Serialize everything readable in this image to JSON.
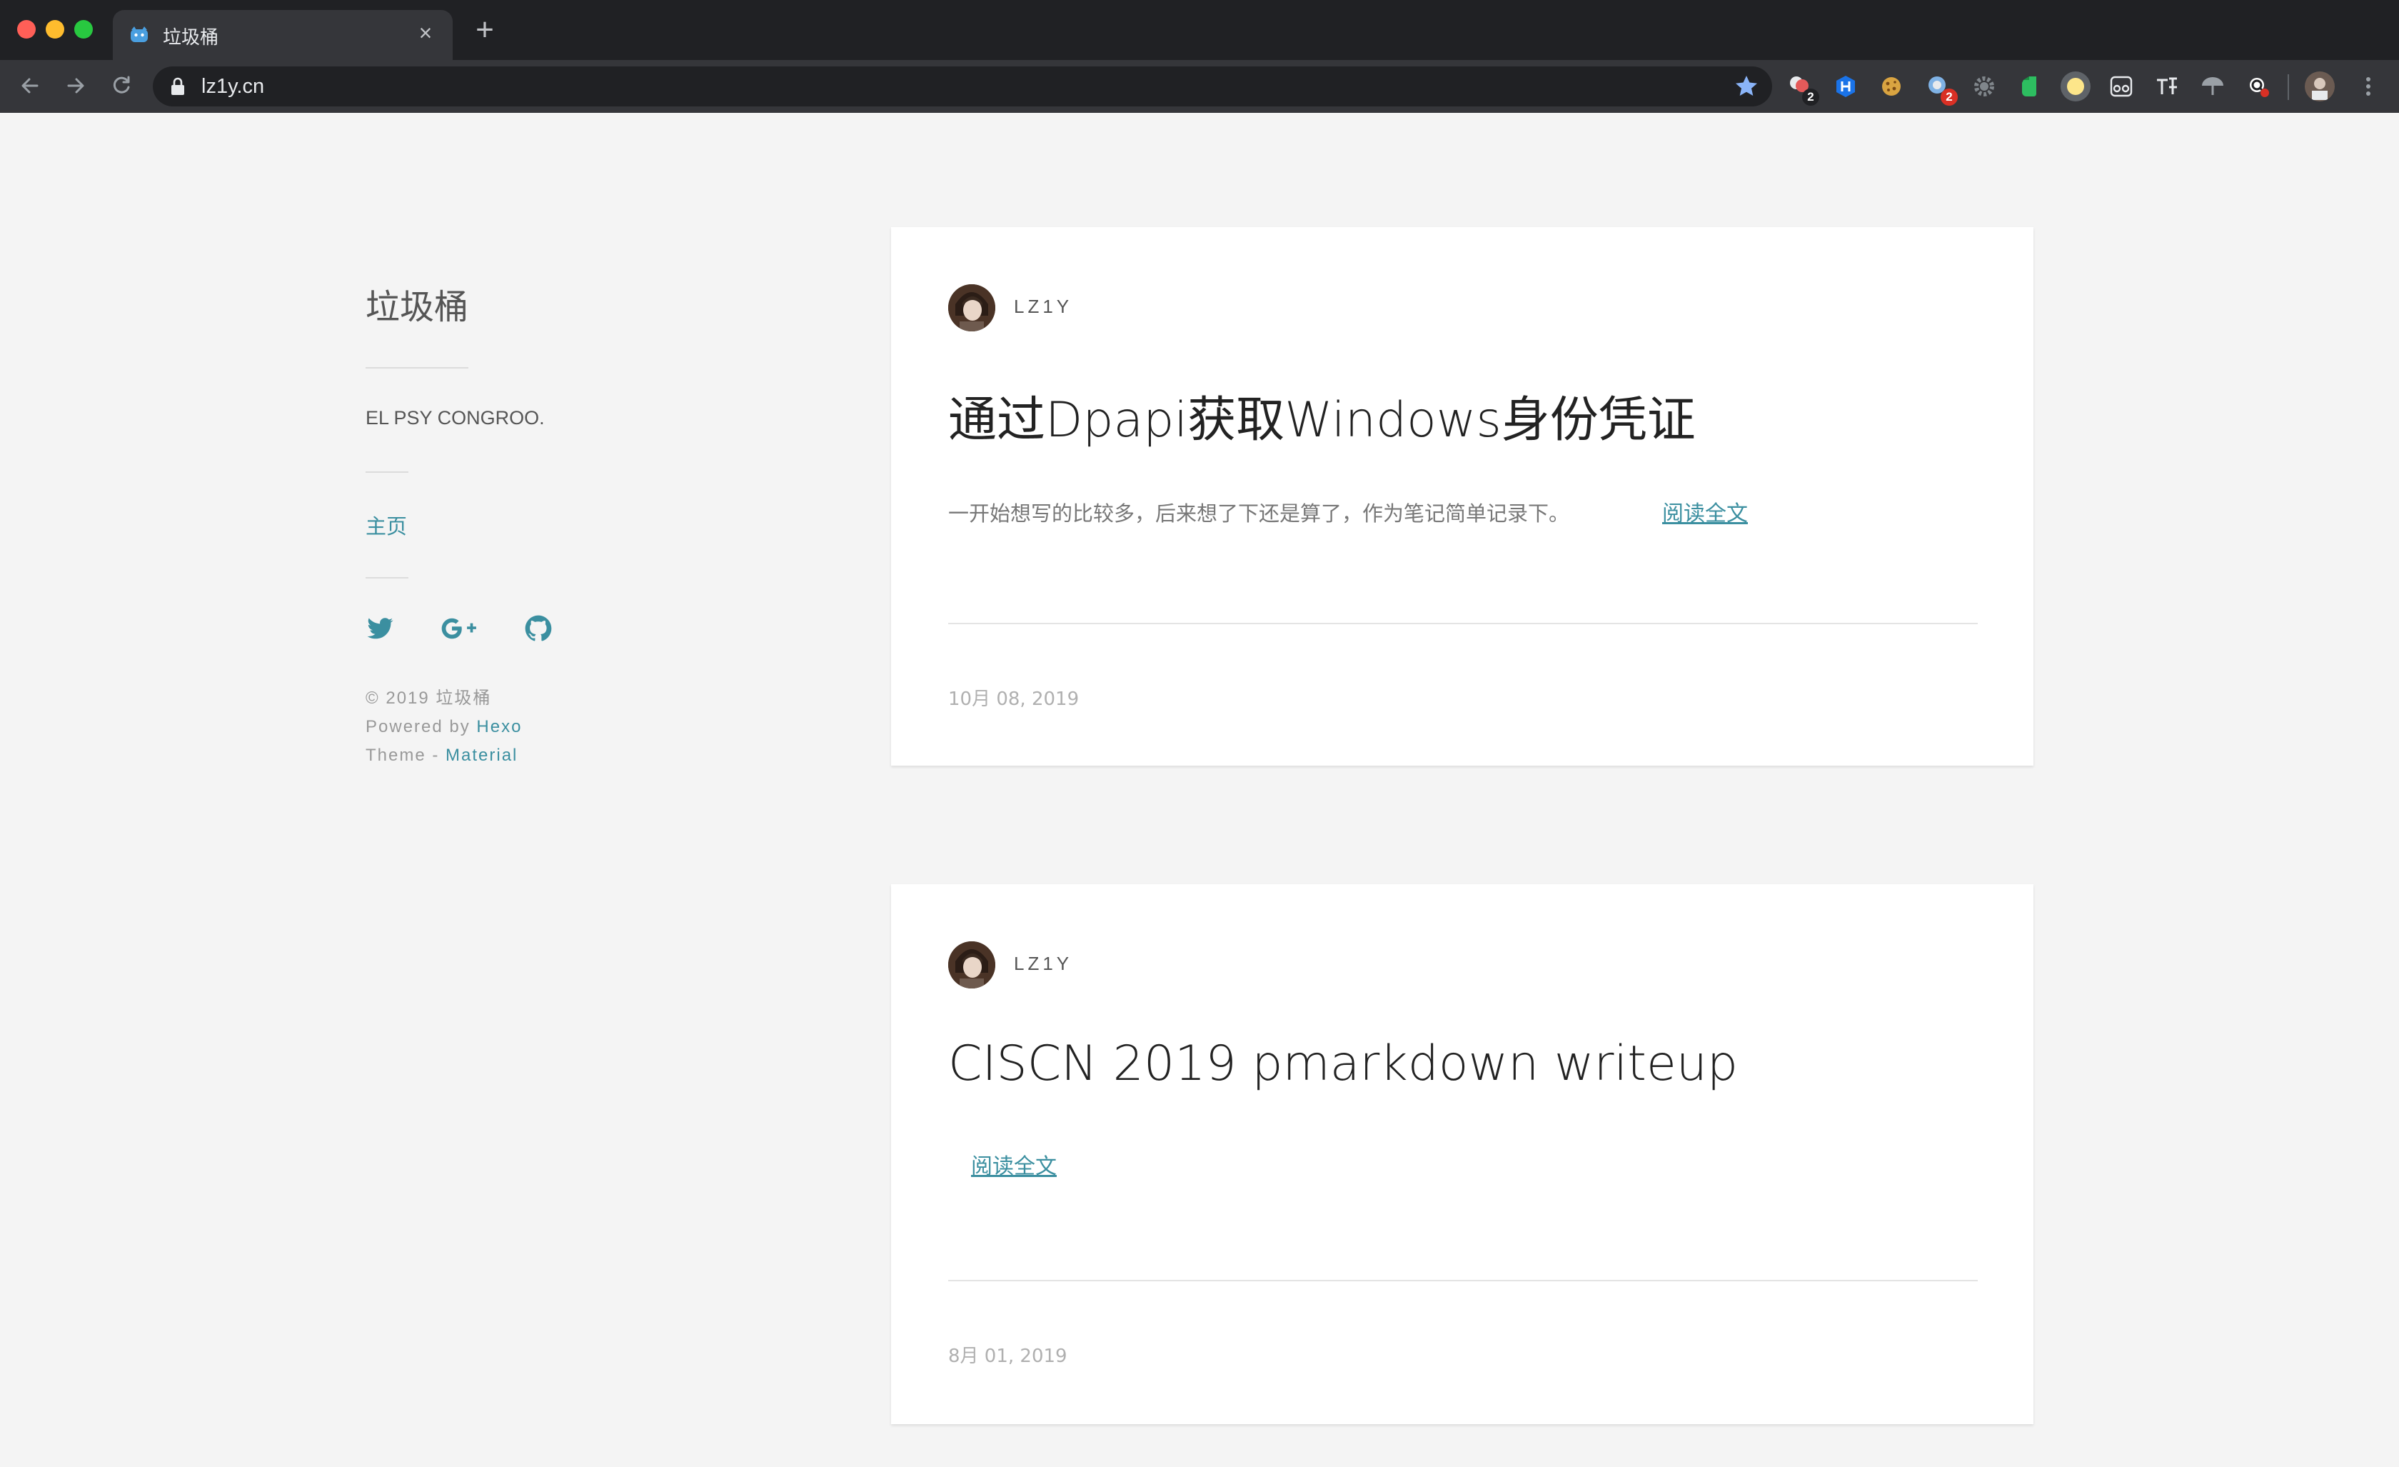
{
  "browser": {
    "tab_title": "垃圾桶",
    "tab_close": "×",
    "new_tab": "+",
    "url": "lz1y.cn",
    "extensions": [
      {
        "icon": "puzzle-red-icon",
        "badge": "2",
        "badge_color": "#202124"
      },
      {
        "icon": "h-blue-icon",
        "badge": ""
      },
      {
        "icon": "cookie-icon",
        "badge": ""
      },
      {
        "icon": "globe-badge-icon",
        "badge": "2",
        "badge_color": "#d93025"
      },
      {
        "icon": "gear-grey-icon",
        "badge": ""
      },
      {
        "icon": "evernote-icon",
        "badge": ""
      },
      {
        "icon": "yellow-circle-icon",
        "badge": ""
      },
      {
        "icon": "glasses-icon",
        "badge": ""
      },
      {
        "icon": "translate-icon",
        "badge": ""
      },
      {
        "icon": "umbrella-icon",
        "badge": ""
      },
      {
        "icon": "search-red-icon",
        "badge": ""
      }
    ]
  },
  "sidebar": {
    "title": "垃圾桶",
    "motto": "EL PSY CONGROO.",
    "nav_home": "主页",
    "social": [
      "twitter-icon",
      "google-plus-icon",
      "github-icon"
    ],
    "footer_copyright": "©  2019  垃圾桶",
    "footer_powered_prefix": "Powered by ",
    "footer_powered_link": "Hexo",
    "footer_theme_prefix": "Theme - ",
    "footer_theme_link": "Material"
  },
  "posts": [
    {
      "author": "LZ1Y",
      "title": "通过Dpapi获取Windows身份凭证",
      "excerpt": "一开始想写的比较多，后来想了下还是算了，作为笔记简单记录下。",
      "read_more": "阅读全文",
      "date": "10月 08, 2019"
    },
    {
      "author": "LZ1Y",
      "title": "CISCN 2019 pmarkdown writeup",
      "excerpt": "",
      "read_more": "阅读全文",
      "date": "8月 01, 2019"
    }
  ],
  "colors": {
    "accent": "#3b8fa0",
    "background": "#f4f4f4",
    "card": "#ffffff"
  }
}
